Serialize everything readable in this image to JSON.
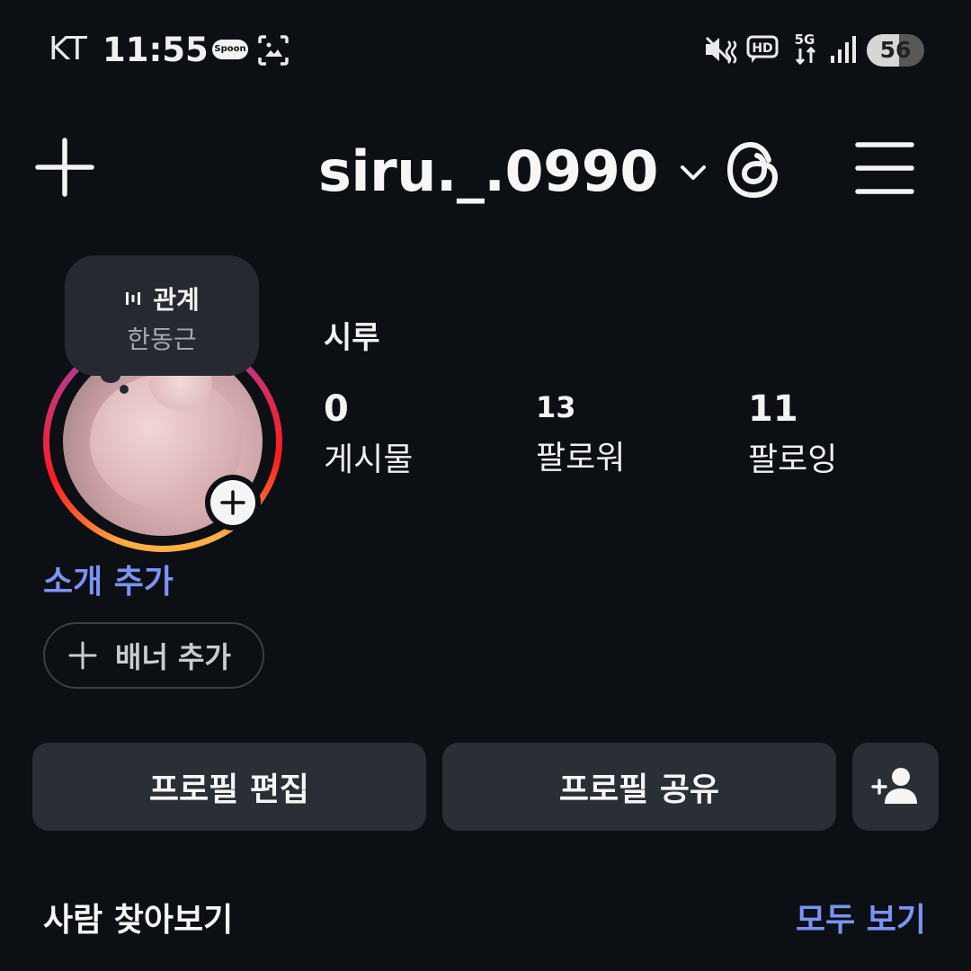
{
  "status_bar": {
    "carrier": "KT",
    "time": "11:55",
    "spoon_label": "Spoon",
    "battery_level": 56,
    "battery_text": "56"
  },
  "header": {
    "username": "siru._.0990",
    "icons": [
      "plus-icon",
      "chevron-down-icon",
      "threads-icon",
      "hamburger-menu-icon"
    ]
  },
  "note": {
    "title": "관계",
    "subtitle": "한동근"
  },
  "profile": {
    "display_name": "시루",
    "stats": {
      "posts_count": "0",
      "posts_label": "게시물",
      "followers_count": "13",
      "followers_label": "팔로워",
      "following_count": "11",
      "following_label": "팔로잉"
    },
    "add_bio_label": "소개 추가",
    "add_banner_label": "배너 추가"
  },
  "actions": {
    "edit_profile": "프로필 편집",
    "share_profile": "프로필 공유"
  },
  "discover": {
    "title": "사람 찾아보기",
    "see_all": "모두 보기"
  },
  "colors": {
    "background": "#0c0f14",
    "button": "#2a2e35",
    "link": "#7b93f3"
  }
}
